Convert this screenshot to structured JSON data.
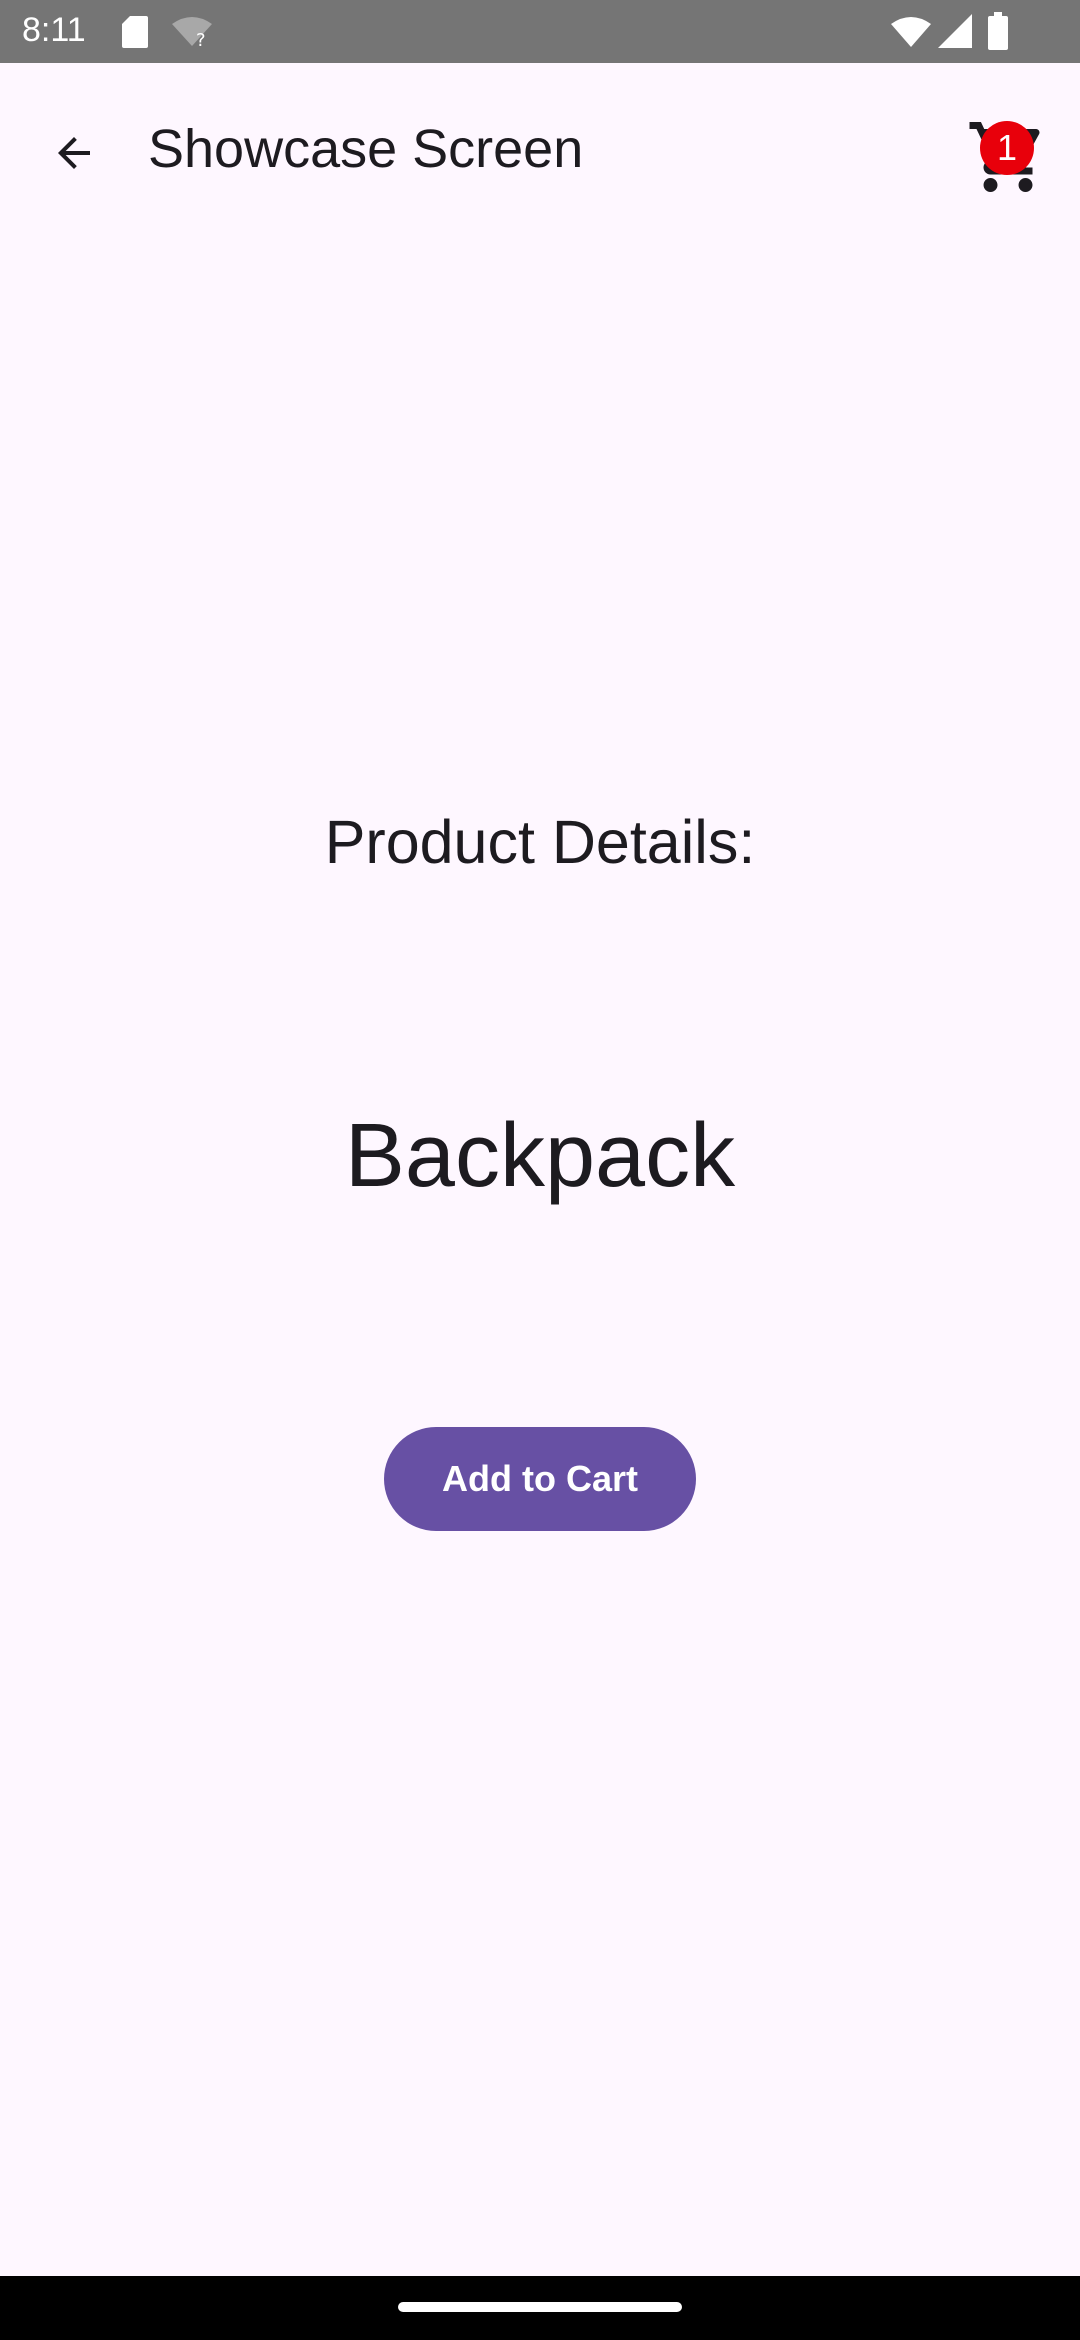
{
  "status_bar": {
    "time": "8:11",
    "icons": [
      "sd-card-icon",
      "wifi-unknown-icon",
      "wifi-signal-icon",
      "cell-signal-icon",
      "battery-icon"
    ]
  },
  "app_bar": {
    "back_icon": "arrow-back-icon",
    "title": "Showcase Screen",
    "cart_icon": "shopping-cart-icon",
    "cart_badge_count": "1"
  },
  "content": {
    "heading": "Product Details:",
    "product_name": "Backpack",
    "add_to_cart_label": "Add to Cart"
  },
  "colors": {
    "background": "#FEF7FF",
    "status_bar": "#757575",
    "primary": "#6750A4",
    "badge": "#E8000B",
    "text": "#1D1B20"
  }
}
